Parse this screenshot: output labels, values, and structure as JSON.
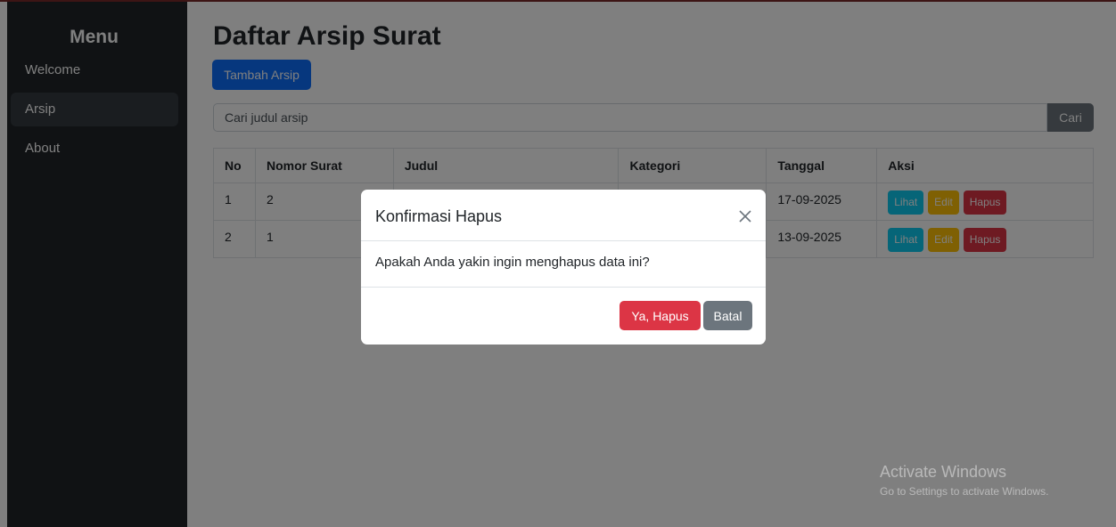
{
  "sidebar": {
    "title": "Menu",
    "items": [
      {
        "label": "Welcome"
      },
      {
        "label": "Arsip",
        "active": true
      },
      {
        "label": "About"
      }
    ]
  },
  "main": {
    "title": "Daftar Arsip Surat",
    "add_button": "Tambah Arsip",
    "search": {
      "placeholder": "Cari judul arsip",
      "button": "Cari"
    },
    "table": {
      "headers": [
        "No",
        "Nomor Surat",
        "Judul",
        "Kategori",
        "Tanggal",
        "Aksi"
      ],
      "rows": [
        {
          "no": "1",
          "nomor_surat": "2",
          "judul": "",
          "kategori": "",
          "tanggal": "17-09-2025"
        },
        {
          "no": "2",
          "nomor_surat": "1",
          "judul": "",
          "kategori": "",
          "tanggal": "13-09-2025"
        }
      ],
      "actions": {
        "view": "Lihat",
        "edit": "Edit",
        "delete": "Hapus"
      }
    }
  },
  "modal": {
    "title": "Konfirmasi Hapus",
    "message": "Apakah Anda yakin ingin menghapus data ini?",
    "confirm_button": "Ya, Hapus",
    "cancel_button": "Batal",
    "close_icon": "close-icon"
  },
  "watermark": {
    "title": "Activate Windows",
    "subtitle": "Go to Settings to activate Windows."
  },
  "colors": {
    "sidebar_bg": "#212529",
    "primary": "#0d6efd",
    "info": "#0dcaf0",
    "warning": "#ffc107",
    "danger": "#dc3545",
    "secondary": "#6c757d"
  }
}
